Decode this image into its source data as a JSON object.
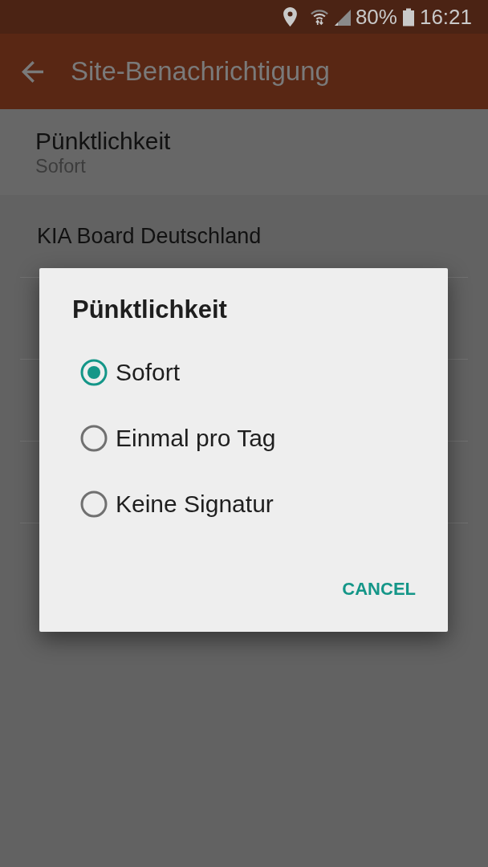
{
  "status_bar": {
    "battery": "80%",
    "time": "16:21"
  },
  "app_bar": {
    "title": "Site-Benachrichtigung"
  },
  "preference": {
    "title": "Pünktlichkeit",
    "summary": "Sofort"
  },
  "section": {
    "title": "KIA Board Deutschland"
  },
  "dialog": {
    "title": "Pünktlichkeit",
    "options": [
      {
        "label": "Sofort",
        "selected": true
      },
      {
        "label": "Einmal pro Tag",
        "selected": false
      },
      {
        "label": "Keine Signatur",
        "selected": false
      }
    ],
    "buttons": [
      "CANCEL"
    ]
  }
}
